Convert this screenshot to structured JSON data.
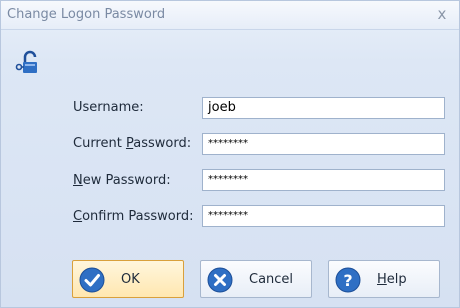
{
  "dialog": {
    "title": "Change Logon Password",
    "close_glyph": "x"
  },
  "icons": {
    "header": "lock-key-icon",
    "ok": "checkmark-icon",
    "cancel": "cancel-x-icon",
    "help": "question-icon"
  },
  "form": {
    "username_label": "Username:",
    "username_value": "joeb",
    "current_label_pre": "Current ",
    "current_label_ul": "P",
    "current_label_post": "assword:",
    "current_value": "********",
    "new_label_ul": "N",
    "new_label_post": "ew Password:",
    "new_value": "********",
    "confirm_label_ul": "C",
    "confirm_label_post": "onfirm Password:",
    "confirm_value": "********"
  },
  "buttons": {
    "ok": "OK",
    "cancel": "Cancel",
    "help_ul": "H",
    "help_post": "elp"
  },
  "colors": {
    "accent_blue": "#2f6fc4",
    "ok_highlight": "#ffe7b0"
  }
}
